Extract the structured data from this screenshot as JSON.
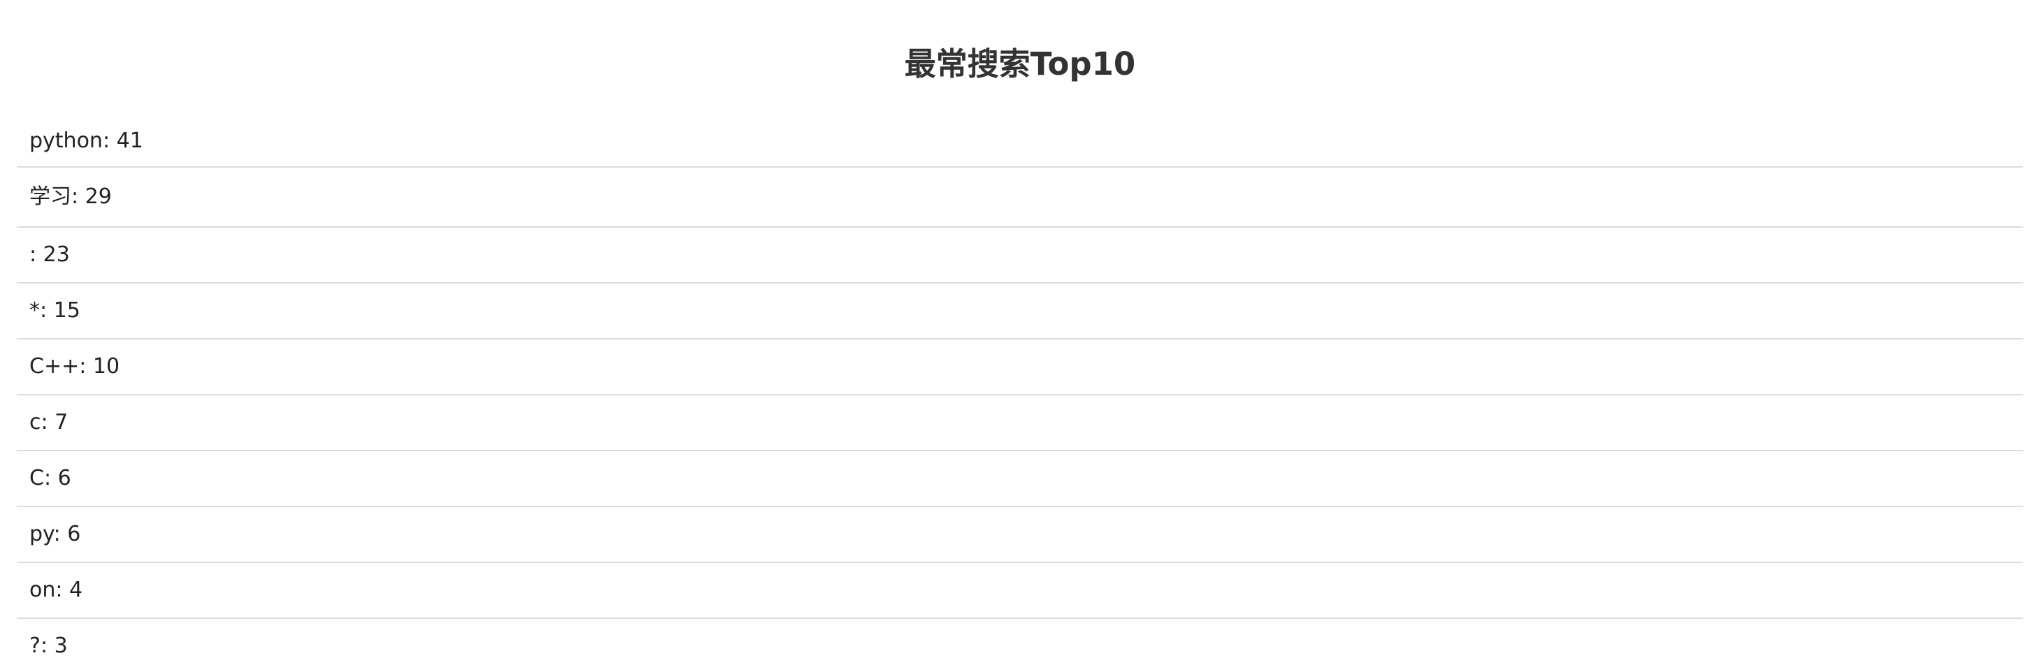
{
  "page": {
    "title": "最常搜索Top10"
  },
  "results": [
    {
      "term": "python",
      "count": 41
    },
    {
      "term": "学习",
      "count": 29
    },
    {
      "term": "",
      "count": 23
    },
    {
      "term": "*",
      "count": 15
    },
    {
      "term": "C++",
      "count": 10
    },
    {
      "term": "c",
      "count": 7
    },
    {
      "term": "C",
      "count": 6
    },
    {
      "term": "py",
      "count": 6
    },
    {
      "term": "on",
      "count": 4
    },
    {
      "term": "?",
      "count": 3
    }
  ]
}
